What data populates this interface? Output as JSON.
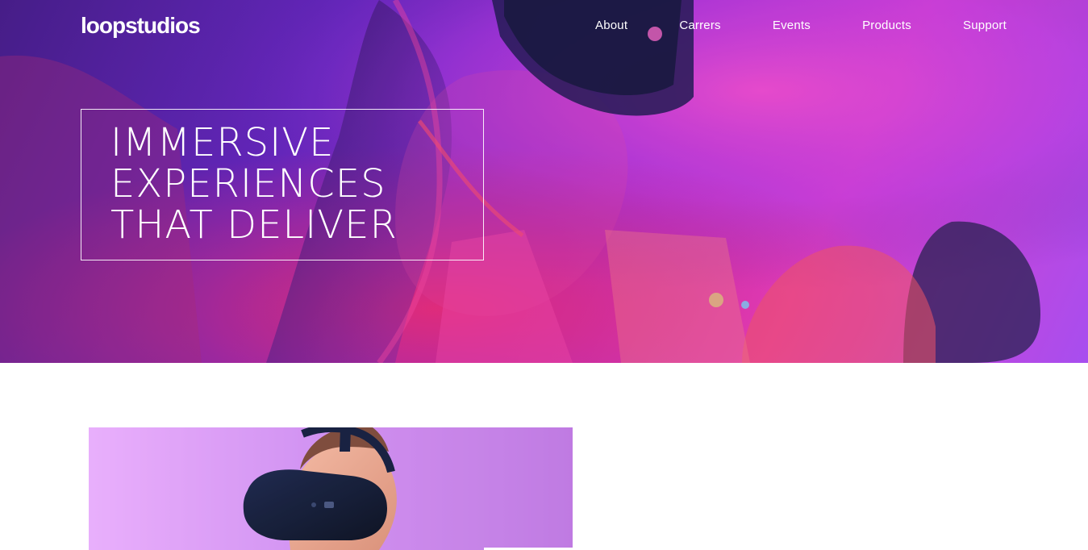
{
  "brand": {
    "logo": "loopstudios"
  },
  "nav": {
    "items": [
      "About",
      "Carrers",
      "Events",
      "Products",
      "Support"
    ]
  },
  "hero": {
    "headline_lines": [
      "IMMERSIVE",
      "EXPERIENCES",
      "THAT DELIVER"
    ]
  },
  "colors": {
    "hero_purple": "#6a28c7",
    "hero_magenta": "#ef43d7",
    "hero_red": "#ff2f74",
    "card_pink": "#d98bf5",
    "text_white": "#ffffff"
  }
}
